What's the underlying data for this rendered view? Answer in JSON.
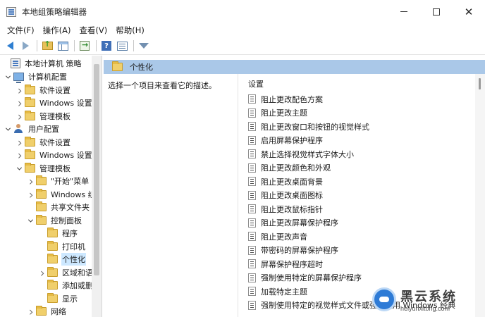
{
  "window": {
    "title": "本地组策略编辑器",
    "controls": {
      "minimize": "—",
      "maximize": "☐",
      "close": "✕"
    }
  },
  "menu": [
    "文件(F)",
    "操作(A)",
    "查看(V)",
    "帮助(H)"
  ],
  "toolbar": {
    "icons": [
      "back-icon",
      "forward-icon",
      "up-folder-icon",
      "show-hide-tree-icon",
      "export-list-icon",
      "help-icon",
      "properties-icon",
      "filter-icon"
    ],
    "help_glyph": "?"
  },
  "tree": {
    "items": [
      {
        "label": "本地计算机 策略",
        "icon": "policy-root-icon",
        "expander": "none",
        "level": 0
      },
      {
        "label": "计算机配置",
        "icon": "computer-icon",
        "expander": "expanded",
        "level": 1
      },
      {
        "label": "软件设置",
        "icon": "folder-icon",
        "expander": "collapsed",
        "level": 2
      },
      {
        "label": "Windows 设置",
        "icon": "folder-icon",
        "expander": "collapsed",
        "level": 2
      },
      {
        "label": "管理模板",
        "icon": "folder-icon",
        "expander": "collapsed",
        "level": 2
      },
      {
        "label": "用户配置",
        "icon": "user-icon",
        "expander": "expanded",
        "level": 1
      },
      {
        "label": "软件设置",
        "icon": "folder-icon",
        "expander": "collapsed",
        "level": 2
      },
      {
        "label": "Windows 设置",
        "icon": "folder-icon",
        "expander": "collapsed",
        "level": 2
      },
      {
        "label": "管理模板",
        "icon": "folder-icon",
        "expander": "expanded",
        "level": 2
      },
      {
        "label": "\"开始\"菜单",
        "icon": "folder-icon",
        "expander": "collapsed",
        "level": 3
      },
      {
        "label": "Windows 组件",
        "icon": "folder-icon",
        "expander": "collapsed",
        "level": 3
      },
      {
        "label": "共享文件夹",
        "icon": "folder-icon",
        "expander": "none",
        "level": 3
      },
      {
        "label": "控制面板",
        "icon": "folder-icon",
        "expander": "expanded",
        "level": 3
      },
      {
        "label": "程序",
        "icon": "folder-icon",
        "expander": "none",
        "level": 4
      },
      {
        "label": "打印机",
        "icon": "folder-icon",
        "expander": "none",
        "level": 4
      },
      {
        "label": "个性化",
        "icon": "folder-icon",
        "expander": "none",
        "level": 4,
        "selected": true
      },
      {
        "label": "区域和语言",
        "icon": "folder-icon",
        "expander": "collapsed",
        "level": 4
      },
      {
        "label": "添加或删除程序",
        "icon": "folder-icon",
        "expander": "none",
        "level": 4
      },
      {
        "label": "显示",
        "icon": "folder-icon",
        "expander": "none",
        "level": 4
      },
      {
        "label": "网络",
        "icon": "folder-icon",
        "expander": "collapsed",
        "level": 3
      }
    ]
  },
  "content": {
    "header_title": "个性化",
    "description": "选择一个项目来查看它的描述。",
    "settings_heading": "设置",
    "settings": [
      "阻止更改配色方案",
      "阻止更改主题",
      "阻止更改窗口和按钮的视觉样式",
      "启用屏幕保护程序",
      "禁止选择视觉样式字体大小",
      "阻止更改颜色和外观",
      "阻止更改桌面背景",
      "阻止更改桌面图标",
      "阻止更改鼠标指针",
      "阻止更改屏幕保护程序",
      "阻止更改声音",
      "带密码的屏幕保护程序",
      "屏幕保护程序超时",
      "强制使用特定的屏幕保护程序",
      "加载特定主题",
      "强制使用特定的视觉样式文件或强制使用 Windows 经典"
    ]
  },
  "watermark": {
    "title": "黑云系统",
    "url": "heiyunxitong.com"
  },
  "colors": {
    "header_band": "#aac8e8",
    "selection": "#cde8ff",
    "folder": "#f0cf6b"
  }
}
